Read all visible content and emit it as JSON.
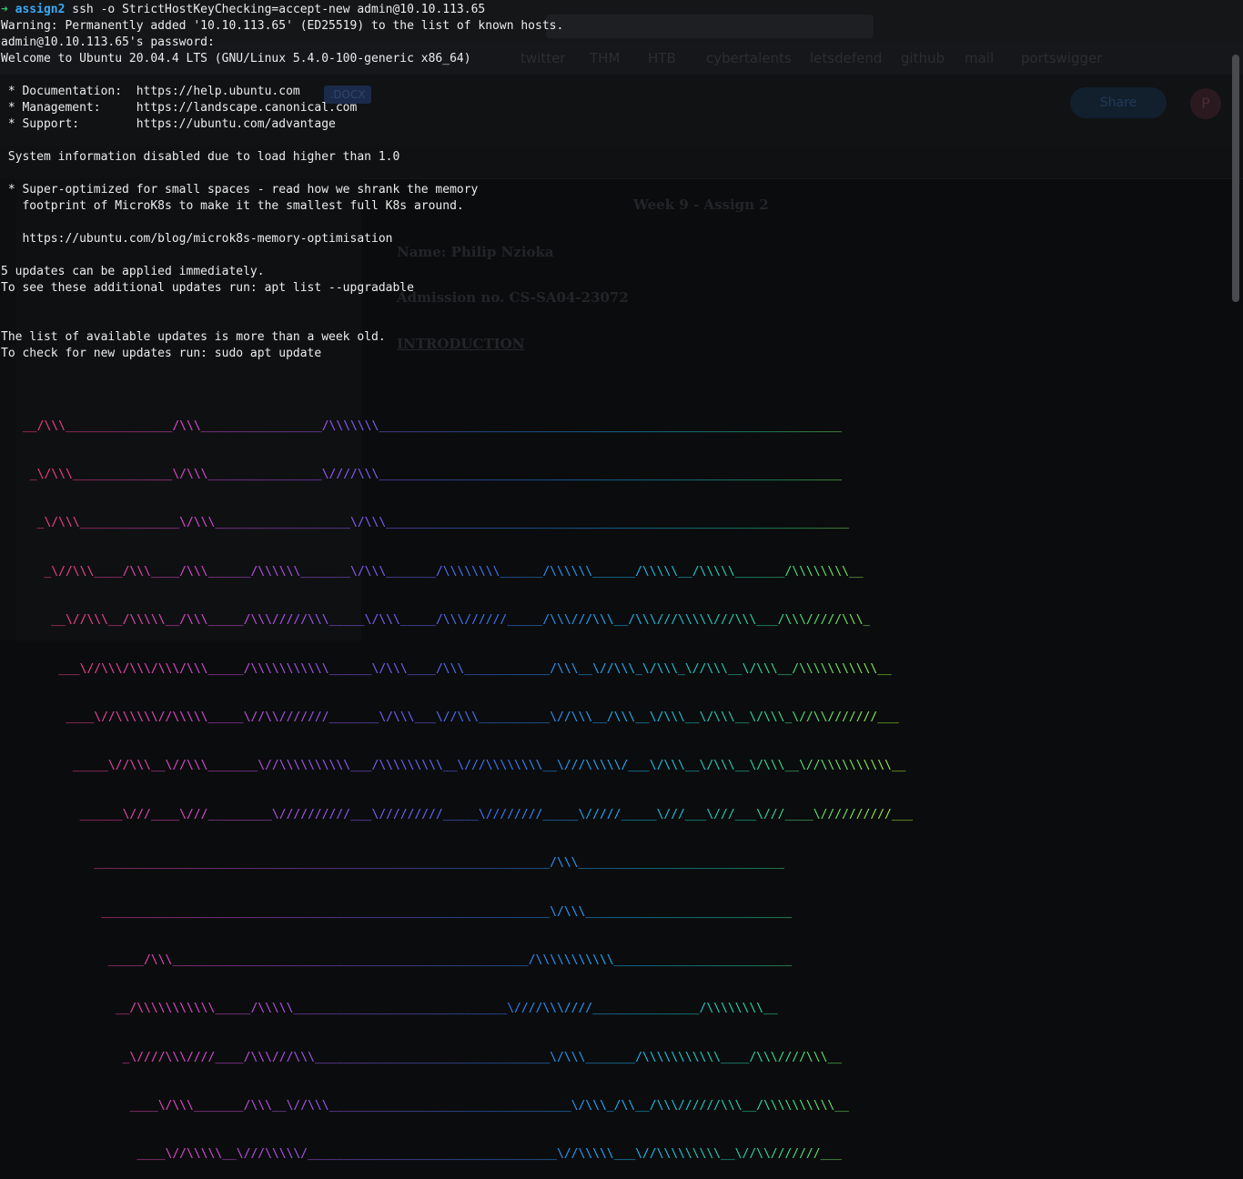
{
  "terminal": {
    "prompt": {
      "arrow": "➜",
      "dir": "assign2",
      "command": "ssh -o StrictHostKeyChecking=accept-new admin@10.10.113.65"
    },
    "lines": [
      "Warning: Permanently added '10.10.113.65' (ED25519) to the list of known hosts.",
      "admin@10.10.113.65's password:",
      "Welcome to Ubuntu 20.04.4 LTS (GNU/Linux 5.4.0-100-generic x86_64)",
      "",
      " * Documentation:  https://help.ubuntu.com",
      " * Management:     https://landscape.canonical.com",
      " * Support:        https://ubuntu.com/advantage",
      "",
      " System information disabled due to load higher than 1.0",
      "",
      " * Super-optimized for small spaces - read how we shrank the memory",
      "   footprint of MicroK8s to make it the smallest full K8s around.",
      "",
      "   https://ubuntu.com/blog/microk8s-memory-optimisation",
      "",
      "5 updates can be applied immediately.",
      "To see these additional updates run: apt list --upgradable",
      "",
      "",
      "The list of available updates is more than a week old.",
      "To check for new updates run: sudo apt update"
    ],
    "banner": [
      "__/\\\\\\_______________/\\\\\\_________________/\\\\\\\\\\\\\\_________________________________________________________________",
      " _\\/\\\\\\______________\\/\\\\\\________________\\////\\\\\\_________________________________________________________________",
      "  _\\/\\\\\\______________\\/\\\\\\___________________\\/\\\\\\_________________________________________________________________",
      "   _\\//\\\\\\____/\\\\\\____/\\\\\\______/\\\\\\\\\\\\_______\\/\\\\\\_______/\\\\\\\\\\\\\\\\______/\\\\\\\\\\\\______/\\\\\\\\\\__/\\\\\\\\\\_______/\\\\\\\\\\\\\\\\__",
      "    __\\//\\\\\\__/\\\\\\\\\\__/\\\\\\_____/\\\\\\/////\\\\\\_____\\/\\\\\\_____/\\\\\\//////_____/\\\\\\///\\\\\\__/\\\\\\///\\\\\\\\\\///\\\\\\___/\\\\\\/////\\\\\\_",
      "     ___\\//\\\\\\/\\\\\\/\\\\\\/\\\\\\_____/\\\\\\\\\\\\\\\\\\\\\\______\\/\\\\\\____/\\\\\\____________/\\\\\\__\\//\\\\\\_\\/\\\\\\_\\//\\\\\\__\\/\\\\\\__/\\\\\\\\\\\\\\\\\\\\\\__",
      "      ____\\//\\\\\\\\\\\\//\\\\\\\\\\_____\\//\\\\///////_______\\/\\\\\\___\\//\\\\\\__________\\//\\\\\\__/\\\\\\__\\/\\\\\\__\\/\\\\\\__\\/\\\\\\_\\//\\\\///////___",
      "       _____\\//\\\\\\__\\//\\\\\\_______\\//\\\\\\\\\\\\\\\\\\\\___/\\\\\\\\\\\\\\\\\\__\\///\\\\\\\\\\\\\\\\__\\///\\\\\\\\\\/___\\/\\\\\\__\\/\\\\\\__\\/\\\\\\__\\//\\\\\\\\\\\\\\\\\\\\__",
      "        ______\\///____\\///_________\\//////////___\\/////////_____\\////////_____\\/////_____\\///___\\///___\\///____\\//////////___",
      "          ________________________________________________________________/\\\\\\_____________________________",
      "           _______________________________________________________________\\/\\\\\\_____________________________",
      "            _____/\\\\\\__________________________________________________/\\\\\\\\\\\\\\\\\\\\\\_________________________",
      "             __/\\\\\\\\\\\\\\\\\\\\\\_____/\\\\\\\\\\______________________________\\////\\\\\\////_______________/\\\\\\\\\\\\\\\\__",
      "              _\\////\\\\\\////____/\\\\\\///\\\\\\_________________________________\\/\\\\\\_______/\\\\\\\\\\\\\\\\\\\\\\____/\\\\\\////\\\\\\__",
      "               ____\\/\\\\\\_______/\\\\\\__\\//\\\\\\__________________________________\\/\\\\\\_/\\\\__/\\\\\\//////\\\\\\__/\\\\\\\\\\\\\\\\\\\\__",
      "                ____\\//\\\\\\\\\\__\\///\\\\\\\\\\/___________________________________\\//\\\\\\\\\\___\\//\\\\\\\\\\\\\\\\\\__\\//\\\\///////___"
    ]
  },
  "background_app": {
    "bookmarks": [
      "twitter",
      "THM",
      "HTB",
      "cybertalents",
      "letsdefend",
      "github",
      "mail",
      "portswigger"
    ],
    "doc_badge": ".DOCX",
    "share_label": "Share",
    "avatar_initial": "P",
    "doc_lines": [
      "Week 9 - Assign 2",
      "Name: Philip Nzioka",
      "Admission no. CS-SA04-23072",
      "INTRODUCTION"
    ]
  },
  "colors": {
    "terminal_bg": "#0b0c0d",
    "terminal_fg": "#ececec",
    "prompt_arrow": "#35c16a",
    "prompt_dir": "#3aa9f5"
  }
}
